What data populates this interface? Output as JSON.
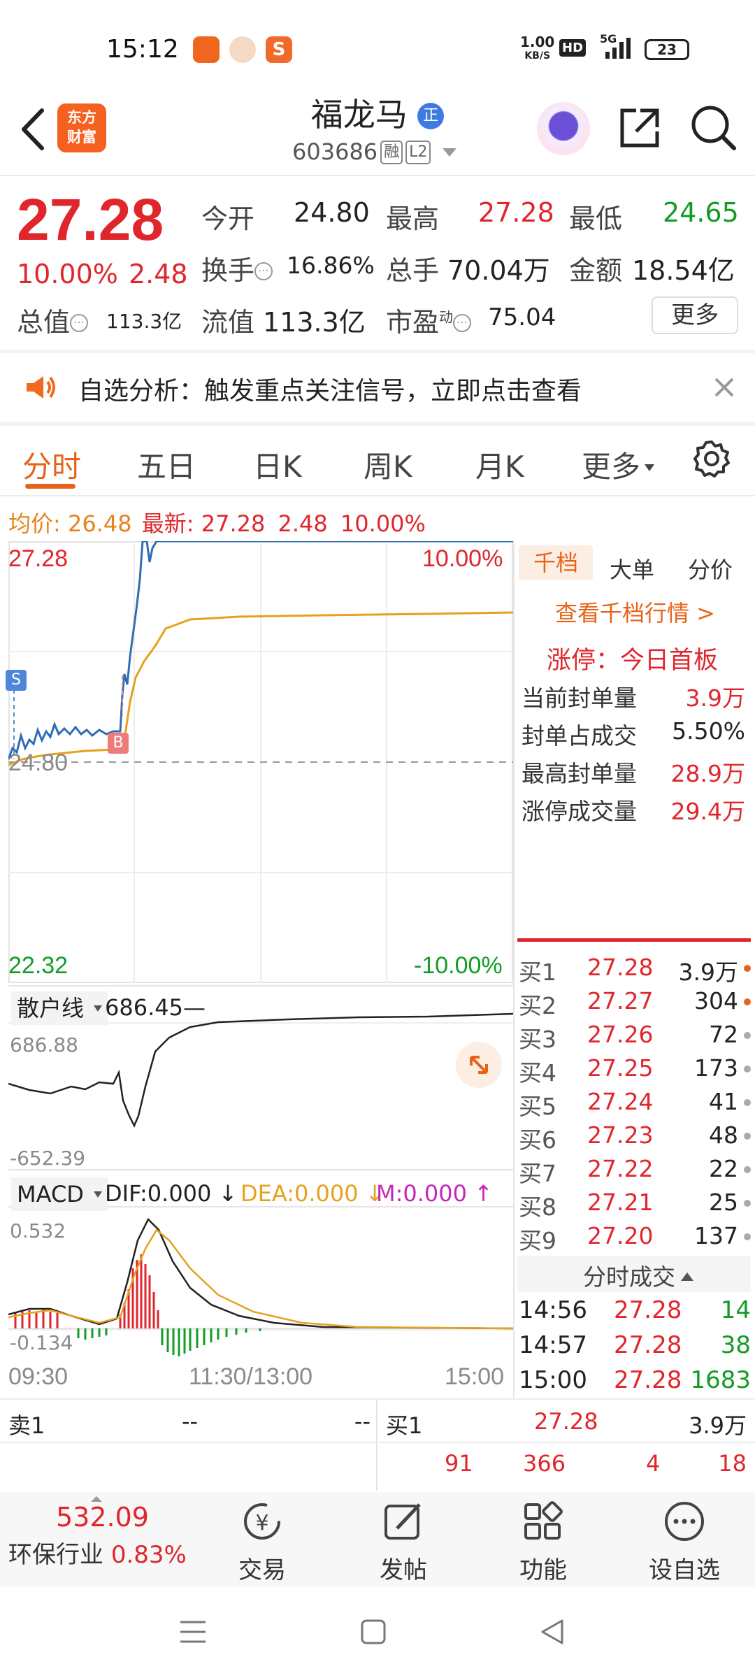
{
  "status_bar": {
    "time": "15:12",
    "net_speed_value": "1.00",
    "net_speed_unit": "KB/S",
    "hd_label": "HD",
    "signal_label": "5G",
    "battery": "23"
  },
  "header": {
    "logo_line1": "东方",
    "logo_line2": "财富",
    "stock_name": "福龙马",
    "name_badge": "正",
    "stock_code": "603686",
    "tag_margin": "融",
    "tag_level": "L2"
  },
  "quote": {
    "price": "27.28",
    "change_pct": "10.00%",
    "change_amt": "2.48",
    "open_label": "今开",
    "open_value": "24.80",
    "high_label": "最高",
    "high_value": "27.28",
    "low_label": "最低",
    "low_value": "24.65",
    "turnover_label": "换手",
    "turnover_value": "16.86%",
    "volume_label": "总手",
    "volume_value": "70.04万",
    "amount_label": "金额",
    "amount_value": "18.54亿",
    "mktcap_label": "总值",
    "mktcap_value": "113.3亿",
    "float_label": "流值",
    "float_value": "113.3亿",
    "pe_label": "市盈",
    "pe_sup": "动",
    "pe_value": "75.04",
    "more_label": "更多"
  },
  "alert": {
    "text": "自选分析：触发重点关注信号，立即点击查看"
  },
  "tabs": [
    "分时",
    "五日",
    "日K",
    "周K",
    "月K",
    "更多"
  ],
  "info_line": {
    "avg_label": "均价:",
    "avg_value": "26.48",
    "latest_label": "最新:",
    "latest_value": "27.28",
    "change_amt": "2.48",
    "change_pct": "10.00%"
  },
  "chart": {
    "y_top": "27.28",
    "y_mid": "24.80",
    "y_bottom": "22.32",
    "pct_top": "10.00%",
    "pct_bottom": "-10.00%",
    "marker_s": "S",
    "marker_b": "B",
    "retail_label": "散户线",
    "retail_value": "686.45",
    "retail_max": "686.88",
    "retail_min": "-652.39",
    "macd_label": "MACD",
    "dif": "DIF:0.000",
    "dea": "DEA:0.000",
    "m": "M:0.000",
    "macd_max": "0.532",
    "macd_min": "-0.134",
    "time_start": "09:30",
    "time_mid": "11:30/13:00",
    "time_end": "15:00"
  },
  "right_panel": {
    "tabs": [
      "千档",
      "大单",
      "分价"
    ],
    "link": "查看千档行情 >",
    "limit_title": "涨停：今日首板",
    "rows": [
      {
        "label": "当前封单量",
        "value": "3.9万"
      },
      {
        "label": "封单占成交",
        "value": "5.50%"
      },
      {
        "label": "最高封单量",
        "value": "28.9万"
      },
      {
        "label": "涨停成交量",
        "value": "29.4万"
      }
    ],
    "book": [
      {
        "label": "买1",
        "price": "27.28",
        "vol": "3.9万"
      },
      {
        "label": "买2",
        "price": "27.27",
        "vol": "304"
      },
      {
        "label": "买3",
        "price": "27.26",
        "vol": "72"
      },
      {
        "label": "买4",
        "price": "27.25",
        "vol": "173"
      },
      {
        "label": "买5",
        "price": "27.24",
        "vol": "41"
      },
      {
        "label": "买6",
        "price": "27.23",
        "vol": "48"
      },
      {
        "label": "买7",
        "price": "27.22",
        "vol": "22"
      },
      {
        "label": "买8",
        "price": "27.21",
        "vol": "25"
      },
      {
        "label": "买9",
        "price": "27.20",
        "vol": "137"
      }
    ],
    "trades_title": "分时成交",
    "trades": [
      {
        "time": "14:56",
        "price": "27.28",
        "vol": "14"
      },
      {
        "time": "14:57",
        "price": "27.28",
        "vol": "38"
      },
      {
        "time": "15:00",
        "price": "27.28",
        "vol": "1683"
      }
    ]
  },
  "bottom_quote": {
    "sell_label": "卖1",
    "sell_price": "--",
    "sell_vol": "--",
    "buy_label": "买1",
    "buy_price": "27.28",
    "buy_vol": "3.9万",
    "queue": [
      "91",
      "366",
      "4",
      "18"
    ]
  },
  "toolbar": {
    "index_value": "532.09",
    "index_name": "环保行业",
    "index_pct": "0.83%",
    "items": [
      "交易",
      "发帖",
      "功能",
      "设自选"
    ]
  },
  "colors": {
    "accent": "#e8631a",
    "up": "#e0262d",
    "down": "#129c27",
    "price_line": "#2e6db4",
    "avg_line": "#e6a11d"
  }
}
